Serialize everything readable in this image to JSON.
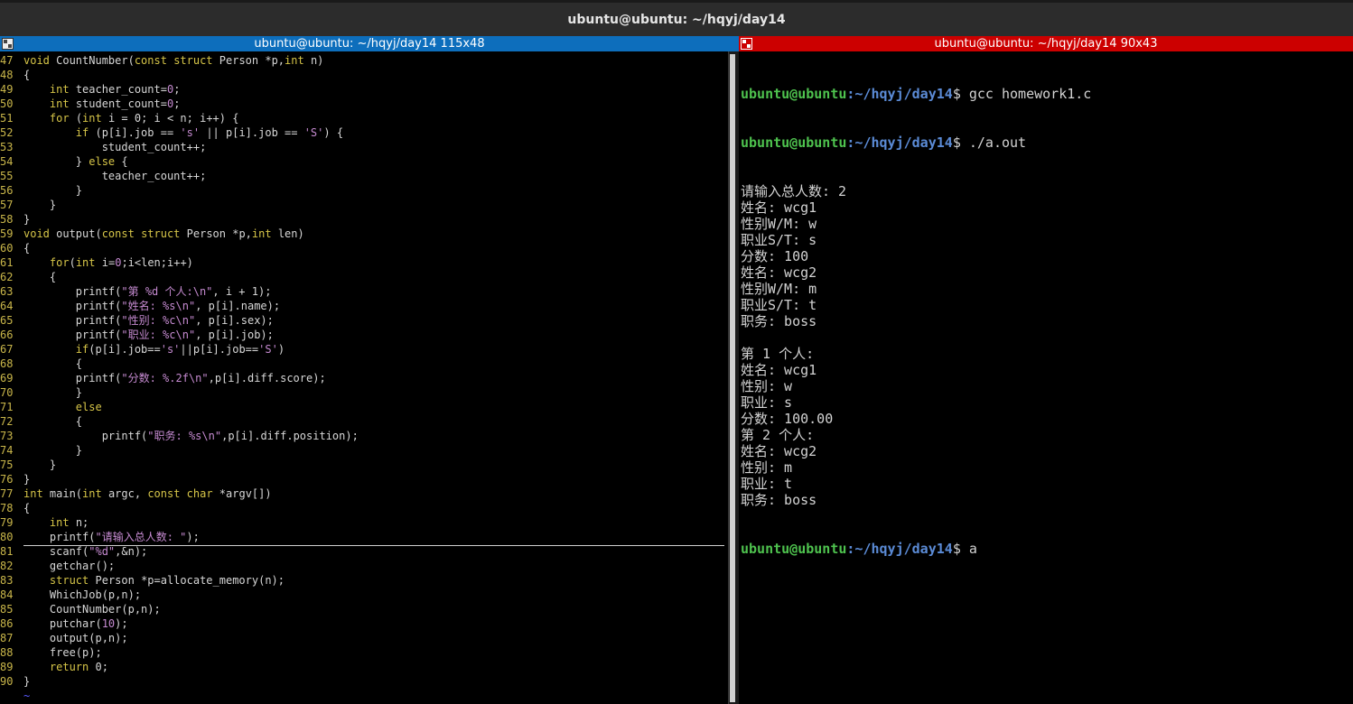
{
  "window": {
    "title": "ubuntu@ubuntu: ~/hqyj/day14"
  },
  "left_pane": {
    "title": "ubuntu@ubuntu: ~/hqyj/day14 115x48"
  },
  "right_pane": {
    "title": "ubuntu@ubuntu: ~/hqyj/day14 90x43"
  },
  "colors": {
    "left_header": "#0d6ebc",
    "right_header": "#cc0000",
    "prompt_user": "#4ec24e",
    "prompt_path": "#5b8bd6",
    "keyword": "#d6c548",
    "string": "#c58ad0"
  },
  "code": [
    {
      "n": "47",
      "text": "void CountNumber(const struct Person *p,int n)"
    },
    {
      "n": "48",
      "text": "{"
    },
    {
      "n": "49",
      "text": "    int teacher_count=0;"
    },
    {
      "n": "50",
      "text": "    int student_count=0;"
    },
    {
      "n": "51",
      "text": "    for (int i = 0; i < n; i++) {"
    },
    {
      "n": "52",
      "text": "        if (p[i].job == 's' || p[i].job == 'S') {"
    },
    {
      "n": "53",
      "text": "            student_count++;"
    },
    {
      "n": "54",
      "text": "        } else {"
    },
    {
      "n": "55",
      "text": "            teacher_count++;"
    },
    {
      "n": "56",
      "text": "        }"
    },
    {
      "n": "57",
      "text": "    }"
    },
    {
      "n": "58",
      "text": "}"
    },
    {
      "n": "59",
      "text": "void output(const struct Person *p,int len)"
    },
    {
      "n": "60",
      "text": "{"
    },
    {
      "n": "61",
      "text": "    for(int i=0;i<len;i++)"
    },
    {
      "n": "62",
      "text": "    {"
    },
    {
      "n": "63",
      "text": "        printf(\"第 %d 个人:\\n\", i + 1);"
    },
    {
      "n": "64",
      "text": "        printf(\"姓名: %s\\n\", p[i].name);"
    },
    {
      "n": "65",
      "text": "        printf(\"性别: %c\\n\", p[i].sex);"
    },
    {
      "n": "66",
      "text": "        printf(\"职业: %c\\n\", p[i].job);"
    },
    {
      "n": "67",
      "text": "        if(p[i].job=='s'||p[i].job=='S')"
    },
    {
      "n": "68",
      "text": "        {"
    },
    {
      "n": "69",
      "text": "        printf(\"分数: %.2f\\n\",p[i].diff.score);"
    },
    {
      "n": "70",
      "text": "        }"
    },
    {
      "n": "71",
      "text": "        else"
    },
    {
      "n": "72",
      "text": "        {"
    },
    {
      "n": "73",
      "text": "            printf(\"职务: %s\\n\",p[i].diff.position);"
    },
    {
      "n": "74",
      "text": "        }"
    },
    {
      "n": "75",
      "text": "    }"
    },
    {
      "n": "76",
      "text": "}"
    },
    {
      "n": "77",
      "text": "int main(int argc, const char *argv[])"
    },
    {
      "n": "78",
      "text": "{"
    },
    {
      "n": "79",
      "text": "    int n;"
    },
    {
      "n": "80",
      "text": "    printf(\"请输入总人数: \");"
    },
    {
      "n": "81",
      "text": "    scanf(\"%d\",&n);"
    },
    {
      "n": "82",
      "text": "    getchar();"
    },
    {
      "n": "83",
      "text": "    struct Person *p=allocate_memory(n);"
    },
    {
      "n": "84",
      "text": "    WhichJob(p,n);"
    },
    {
      "n": "85",
      "text": "    CountNumber(p,n);"
    },
    {
      "n": "86",
      "text": "    putchar(10);"
    },
    {
      "n": "87",
      "text": "    output(p,n);"
    },
    {
      "n": "88",
      "text": "    free(p);"
    },
    {
      "n": "89",
      "text": "    return 0;"
    },
    {
      "n": "90",
      "text": "}"
    },
    {
      "n": "",
      "text": "~"
    }
  ],
  "terminal": {
    "prompt_user": "ubuntu@ubuntu",
    "prompt_path": ":~/hqyj/day14",
    "commands": [
      {
        "cmd": "$ gcc homework1.c"
      },
      {
        "cmd": "$ ./a.out"
      }
    ],
    "output": [
      "请输入总人数: 2",
      "姓名: wcg1",
      "性别W/M: w",
      "职业S/T: s",
      "分数: 100",
      "姓名: wcg2",
      "性别W/M: m",
      "职业S/T: t",
      "职务: boss",
      "",
      "第 1 个人:",
      "姓名: wcg1",
      "性别: w",
      "职业: s",
      "分数: 100.00",
      "第 2 个人:",
      "姓名: wcg2",
      "性别: m",
      "职业: t",
      "职务: boss"
    ],
    "last_cmd": "$ a"
  }
}
